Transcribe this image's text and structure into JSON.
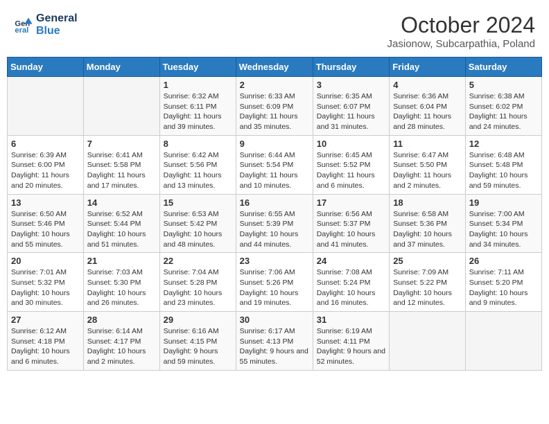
{
  "header": {
    "logo_line1": "General",
    "logo_line2": "Blue",
    "month": "October 2024",
    "location": "Jasionow, Subcarpathia, Poland"
  },
  "days_of_week": [
    "Sunday",
    "Monday",
    "Tuesday",
    "Wednesday",
    "Thursday",
    "Friday",
    "Saturday"
  ],
  "weeks": [
    [
      {
        "day": "",
        "content": ""
      },
      {
        "day": "",
        "content": ""
      },
      {
        "day": "1",
        "content": "Sunrise: 6:32 AM\nSunset: 6:11 PM\nDaylight: 11 hours and 39 minutes."
      },
      {
        "day": "2",
        "content": "Sunrise: 6:33 AM\nSunset: 6:09 PM\nDaylight: 11 hours and 35 minutes."
      },
      {
        "day": "3",
        "content": "Sunrise: 6:35 AM\nSunset: 6:07 PM\nDaylight: 11 hours and 31 minutes."
      },
      {
        "day": "4",
        "content": "Sunrise: 6:36 AM\nSunset: 6:04 PM\nDaylight: 11 hours and 28 minutes."
      },
      {
        "day": "5",
        "content": "Sunrise: 6:38 AM\nSunset: 6:02 PM\nDaylight: 11 hours and 24 minutes."
      }
    ],
    [
      {
        "day": "6",
        "content": "Sunrise: 6:39 AM\nSunset: 6:00 PM\nDaylight: 11 hours and 20 minutes."
      },
      {
        "day": "7",
        "content": "Sunrise: 6:41 AM\nSunset: 5:58 PM\nDaylight: 11 hours and 17 minutes."
      },
      {
        "day": "8",
        "content": "Sunrise: 6:42 AM\nSunset: 5:56 PM\nDaylight: 11 hours and 13 minutes."
      },
      {
        "day": "9",
        "content": "Sunrise: 6:44 AM\nSunset: 5:54 PM\nDaylight: 11 hours and 10 minutes."
      },
      {
        "day": "10",
        "content": "Sunrise: 6:45 AM\nSunset: 5:52 PM\nDaylight: 11 hours and 6 minutes."
      },
      {
        "day": "11",
        "content": "Sunrise: 6:47 AM\nSunset: 5:50 PM\nDaylight: 11 hours and 2 minutes."
      },
      {
        "day": "12",
        "content": "Sunrise: 6:48 AM\nSunset: 5:48 PM\nDaylight: 10 hours and 59 minutes."
      }
    ],
    [
      {
        "day": "13",
        "content": "Sunrise: 6:50 AM\nSunset: 5:46 PM\nDaylight: 10 hours and 55 minutes."
      },
      {
        "day": "14",
        "content": "Sunrise: 6:52 AM\nSunset: 5:44 PM\nDaylight: 10 hours and 51 minutes."
      },
      {
        "day": "15",
        "content": "Sunrise: 6:53 AM\nSunset: 5:42 PM\nDaylight: 10 hours and 48 minutes."
      },
      {
        "day": "16",
        "content": "Sunrise: 6:55 AM\nSunset: 5:39 PM\nDaylight: 10 hours and 44 minutes."
      },
      {
        "day": "17",
        "content": "Sunrise: 6:56 AM\nSunset: 5:37 PM\nDaylight: 10 hours and 41 minutes."
      },
      {
        "day": "18",
        "content": "Sunrise: 6:58 AM\nSunset: 5:36 PM\nDaylight: 10 hours and 37 minutes."
      },
      {
        "day": "19",
        "content": "Sunrise: 7:00 AM\nSunset: 5:34 PM\nDaylight: 10 hours and 34 minutes."
      }
    ],
    [
      {
        "day": "20",
        "content": "Sunrise: 7:01 AM\nSunset: 5:32 PM\nDaylight: 10 hours and 30 minutes."
      },
      {
        "day": "21",
        "content": "Sunrise: 7:03 AM\nSunset: 5:30 PM\nDaylight: 10 hours and 26 minutes."
      },
      {
        "day": "22",
        "content": "Sunrise: 7:04 AM\nSunset: 5:28 PM\nDaylight: 10 hours and 23 minutes."
      },
      {
        "day": "23",
        "content": "Sunrise: 7:06 AM\nSunset: 5:26 PM\nDaylight: 10 hours and 19 minutes."
      },
      {
        "day": "24",
        "content": "Sunrise: 7:08 AM\nSunset: 5:24 PM\nDaylight: 10 hours and 16 minutes."
      },
      {
        "day": "25",
        "content": "Sunrise: 7:09 AM\nSunset: 5:22 PM\nDaylight: 10 hours and 12 minutes."
      },
      {
        "day": "26",
        "content": "Sunrise: 7:11 AM\nSunset: 5:20 PM\nDaylight: 10 hours and 9 minutes."
      }
    ],
    [
      {
        "day": "27",
        "content": "Sunrise: 6:12 AM\nSunset: 4:18 PM\nDaylight: 10 hours and 6 minutes."
      },
      {
        "day": "28",
        "content": "Sunrise: 6:14 AM\nSunset: 4:17 PM\nDaylight: 10 hours and 2 minutes."
      },
      {
        "day": "29",
        "content": "Sunrise: 6:16 AM\nSunset: 4:15 PM\nDaylight: 9 hours and 59 minutes."
      },
      {
        "day": "30",
        "content": "Sunrise: 6:17 AM\nSunset: 4:13 PM\nDaylight: 9 hours and 55 minutes."
      },
      {
        "day": "31",
        "content": "Sunrise: 6:19 AM\nSunset: 4:11 PM\nDaylight: 9 hours and 52 minutes."
      },
      {
        "day": "",
        "content": ""
      },
      {
        "day": "",
        "content": ""
      }
    ]
  ]
}
